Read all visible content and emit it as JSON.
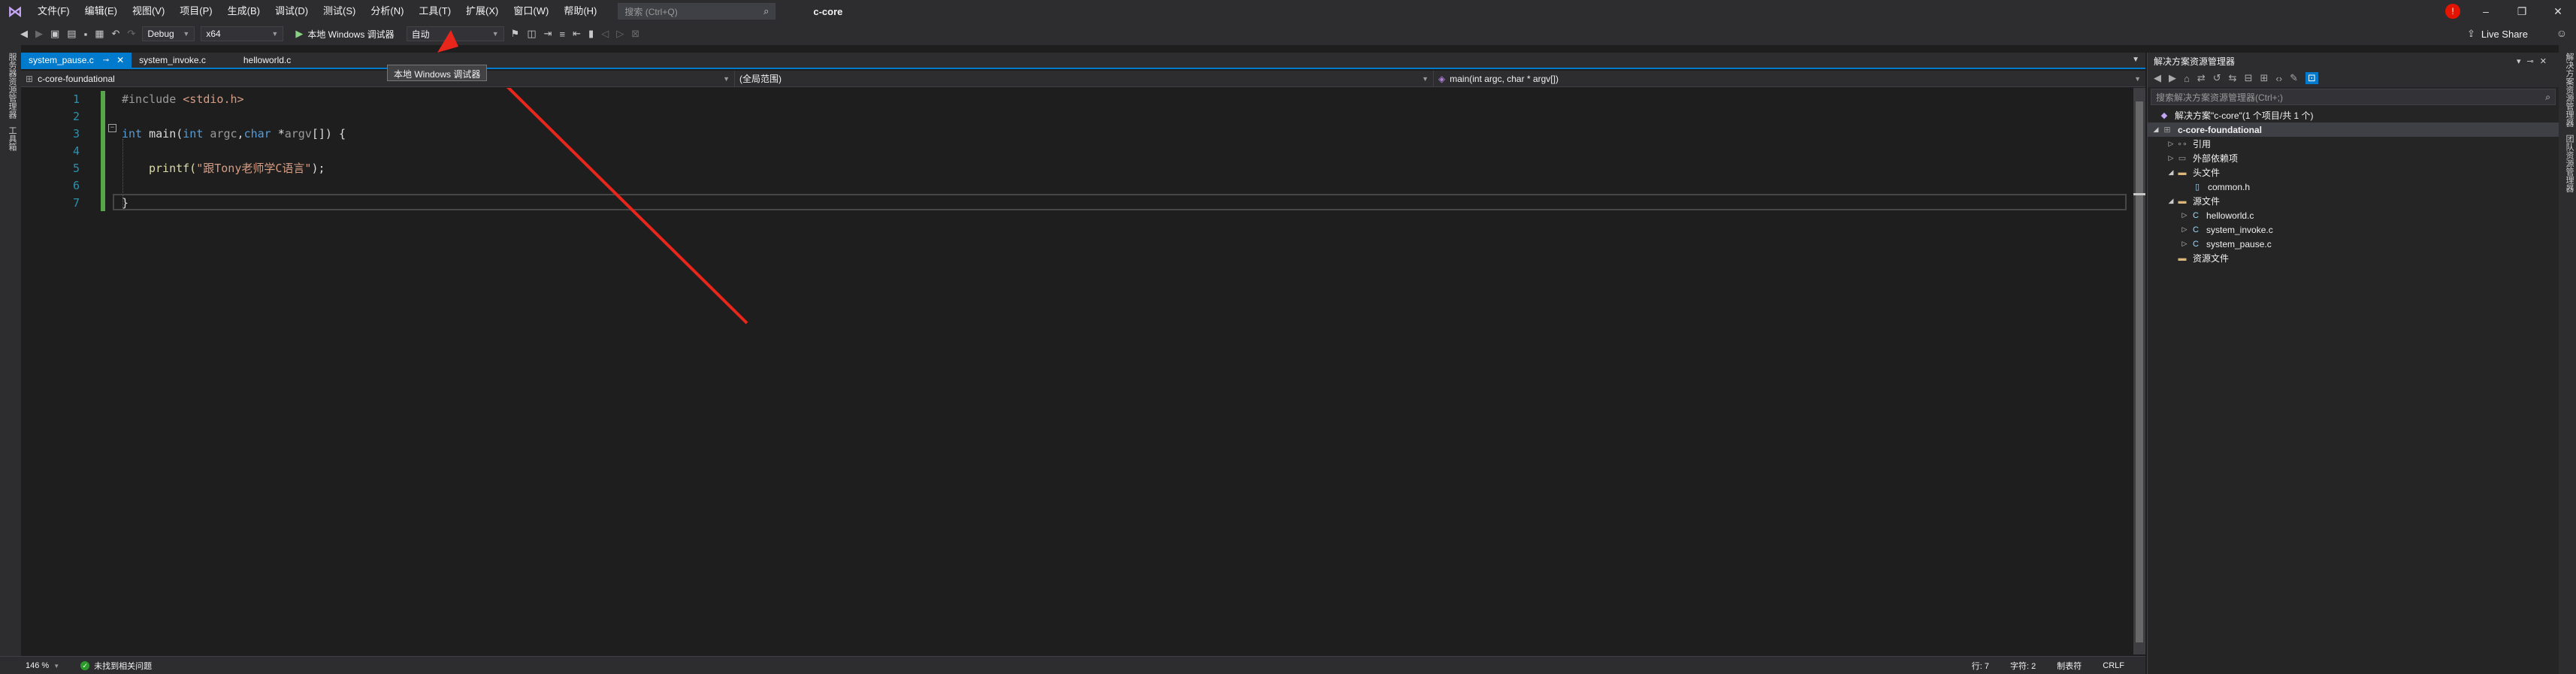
{
  "title_bar": {
    "app_logo": "visual-studio-logo",
    "menu_items": [
      "文件(F)",
      "编辑(E)",
      "视图(V)",
      "项目(P)",
      "生成(B)",
      "调试(D)",
      "测试(S)",
      "分析(N)",
      "工具(T)",
      "扩展(X)",
      "窗口(W)",
      "帮助(H)"
    ],
    "search_placeholder": "搜索 (Ctrl+Q)",
    "document_title": "c-core",
    "notification_count": "!",
    "window_controls": {
      "minimize": "–",
      "restore": "❐",
      "close": "✕"
    }
  },
  "toolbar": {
    "configuration": "Debug",
    "platform": "x64",
    "run_label": "本地 Windows 调试器",
    "run_mode": "自动",
    "live_share": "Live Share"
  },
  "tooltip": "本地 Windows 调试器",
  "left_strip": {
    "labels": [
      "服务器资源管理器",
      "工具箱"
    ]
  },
  "tabs": [
    {
      "label": "system_pause.c",
      "active": true
    },
    {
      "label": "system_invoke.c",
      "active": false
    },
    {
      "label": "helloworld.c",
      "active": false
    }
  ],
  "navbar": {
    "project": "c-core-foundational",
    "scope": "(全局范围)",
    "function": "main(int argc, char * argv[])"
  },
  "editor": {
    "line_numbers": [
      "1",
      "2",
      "3",
      "4",
      "5",
      "6",
      "7"
    ],
    "line1": {
      "directive": "#include ",
      "header": "<stdio.h>"
    },
    "line3": {
      "kw1": "int",
      "name": " main(",
      "kw2": "int",
      "p1": " argc",
      "comma": ",",
      "kw3": "char",
      "star": " *",
      "p2": "argv",
      "rest": "[]) {"
    },
    "line5": {
      "fn": "printf(",
      "str": "\"跟Tony老师学C语言\"",
      "end": ");"
    },
    "line7": {
      "brace": "}"
    }
  },
  "status_bar": {
    "zoom": "146 %",
    "issues": "未找到相关问题",
    "line": "行: 7",
    "char": "字符: 2",
    "tabs": "制表符",
    "eol": "CRLF"
  },
  "solution_explorer": {
    "title": "解决方案资源管理器",
    "search_placeholder": "搜索解决方案资源管理器(Ctrl+;)",
    "solution": "解决方案\"c-core\"(1 个项目/共 1 个)",
    "project": "c-core-foundational",
    "nodes": {
      "refs": "引用",
      "external": "外部依赖项",
      "headers": "头文件",
      "common_h": "common.h",
      "sources": "源文件",
      "helloworld": "helloworld.c",
      "invoke": "system_invoke.c",
      "pause": "system_pause.c",
      "resources": "资源文件"
    }
  },
  "right_strip": {
    "labels": [
      "解决方案资源管理器",
      "团队资源管理器"
    ]
  },
  "colors": {
    "accent": "#007acc",
    "annotation_arrow": "#e8261c",
    "change_bar": "#57a64a"
  }
}
